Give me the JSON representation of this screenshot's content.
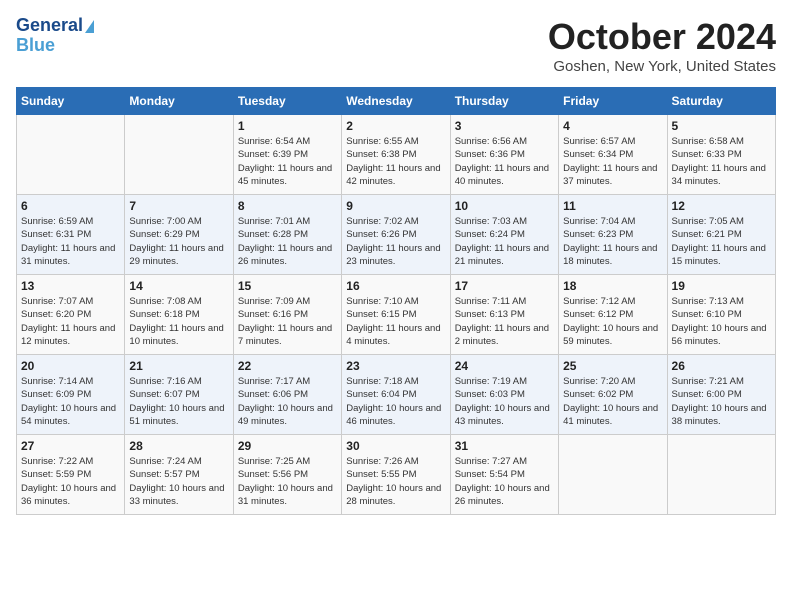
{
  "header": {
    "logo_line1": "General",
    "logo_line2": "Blue",
    "month": "October 2024",
    "location": "Goshen, New York, United States"
  },
  "days_of_week": [
    "Sunday",
    "Monday",
    "Tuesday",
    "Wednesday",
    "Thursday",
    "Friday",
    "Saturday"
  ],
  "weeks": [
    [
      {
        "day": "",
        "info": ""
      },
      {
        "day": "",
        "info": ""
      },
      {
        "day": "1",
        "info": "Sunrise: 6:54 AM\nSunset: 6:39 PM\nDaylight: 11 hours and 45 minutes."
      },
      {
        "day": "2",
        "info": "Sunrise: 6:55 AM\nSunset: 6:38 PM\nDaylight: 11 hours and 42 minutes."
      },
      {
        "day": "3",
        "info": "Sunrise: 6:56 AM\nSunset: 6:36 PM\nDaylight: 11 hours and 40 minutes."
      },
      {
        "day": "4",
        "info": "Sunrise: 6:57 AM\nSunset: 6:34 PM\nDaylight: 11 hours and 37 minutes."
      },
      {
        "day": "5",
        "info": "Sunrise: 6:58 AM\nSunset: 6:33 PM\nDaylight: 11 hours and 34 minutes."
      }
    ],
    [
      {
        "day": "6",
        "info": "Sunrise: 6:59 AM\nSunset: 6:31 PM\nDaylight: 11 hours and 31 minutes."
      },
      {
        "day": "7",
        "info": "Sunrise: 7:00 AM\nSunset: 6:29 PM\nDaylight: 11 hours and 29 minutes."
      },
      {
        "day": "8",
        "info": "Sunrise: 7:01 AM\nSunset: 6:28 PM\nDaylight: 11 hours and 26 minutes."
      },
      {
        "day": "9",
        "info": "Sunrise: 7:02 AM\nSunset: 6:26 PM\nDaylight: 11 hours and 23 minutes."
      },
      {
        "day": "10",
        "info": "Sunrise: 7:03 AM\nSunset: 6:24 PM\nDaylight: 11 hours and 21 minutes."
      },
      {
        "day": "11",
        "info": "Sunrise: 7:04 AM\nSunset: 6:23 PM\nDaylight: 11 hours and 18 minutes."
      },
      {
        "day": "12",
        "info": "Sunrise: 7:05 AM\nSunset: 6:21 PM\nDaylight: 11 hours and 15 minutes."
      }
    ],
    [
      {
        "day": "13",
        "info": "Sunrise: 7:07 AM\nSunset: 6:20 PM\nDaylight: 11 hours and 12 minutes."
      },
      {
        "day": "14",
        "info": "Sunrise: 7:08 AM\nSunset: 6:18 PM\nDaylight: 11 hours and 10 minutes."
      },
      {
        "day": "15",
        "info": "Sunrise: 7:09 AM\nSunset: 6:16 PM\nDaylight: 11 hours and 7 minutes."
      },
      {
        "day": "16",
        "info": "Sunrise: 7:10 AM\nSunset: 6:15 PM\nDaylight: 11 hours and 4 minutes."
      },
      {
        "day": "17",
        "info": "Sunrise: 7:11 AM\nSunset: 6:13 PM\nDaylight: 11 hours and 2 minutes."
      },
      {
        "day": "18",
        "info": "Sunrise: 7:12 AM\nSunset: 6:12 PM\nDaylight: 10 hours and 59 minutes."
      },
      {
        "day": "19",
        "info": "Sunrise: 7:13 AM\nSunset: 6:10 PM\nDaylight: 10 hours and 56 minutes."
      }
    ],
    [
      {
        "day": "20",
        "info": "Sunrise: 7:14 AM\nSunset: 6:09 PM\nDaylight: 10 hours and 54 minutes."
      },
      {
        "day": "21",
        "info": "Sunrise: 7:16 AM\nSunset: 6:07 PM\nDaylight: 10 hours and 51 minutes."
      },
      {
        "day": "22",
        "info": "Sunrise: 7:17 AM\nSunset: 6:06 PM\nDaylight: 10 hours and 49 minutes."
      },
      {
        "day": "23",
        "info": "Sunrise: 7:18 AM\nSunset: 6:04 PM\nDaylight: 10 hours and 46 minutes."
      },
      {
        "day": "24",
        "info": "Sunrise: 7:19 AM\nSunset: 6:03 PM\nDaylight: 10 hours and 43 minutes."
      },
      {
        "day": "25",
        "info": "Sunrise: 7:20 AM\nSunset: 6:02 PM\nDaylight: 10 hours and 41 minutes."
      },
      {
        "day": "26",
        "info": "Sunrise: 7:21 AM\nSunset: 6:00 PM\nDaylight: 10 hours and 38 minutes."
      }
    ],
    [
      {
        "day": "27",
        "info": "Sunrise: 7:22 AM\nSunset: 5:59 PM\nDaylight: 10 hours and 36 minutes."
      },
      {
        "day": "28",
        "info": "Sunrise: 7:24 AM\nSunset: 5:57 PM\nDaylight: 10 hours and 33 minutes."
      },
      {
        "day": "29",
        "info": "Sunrise: 7:25 AM\nSunset: 5:56 PM\nDaylight: 10 hours and 31 minutes."
      },
      {
        "day": "30",
        "info": "Sunrise: 7:26 AM\nSunset: 5:55 PM\nDaylight: 10 hours and 28 minutes."
      },
      {
        "day": "31",
        "info": "Sunrise: 7:27 AM\nSunset: 5:54 PM\nDaylight: 10 hours and 26 minutes."
      },
      {
        "day": "",
        "info": ""
      },
      {
        "day": "",
        "info": ""
      }
    ]
  ]
}
